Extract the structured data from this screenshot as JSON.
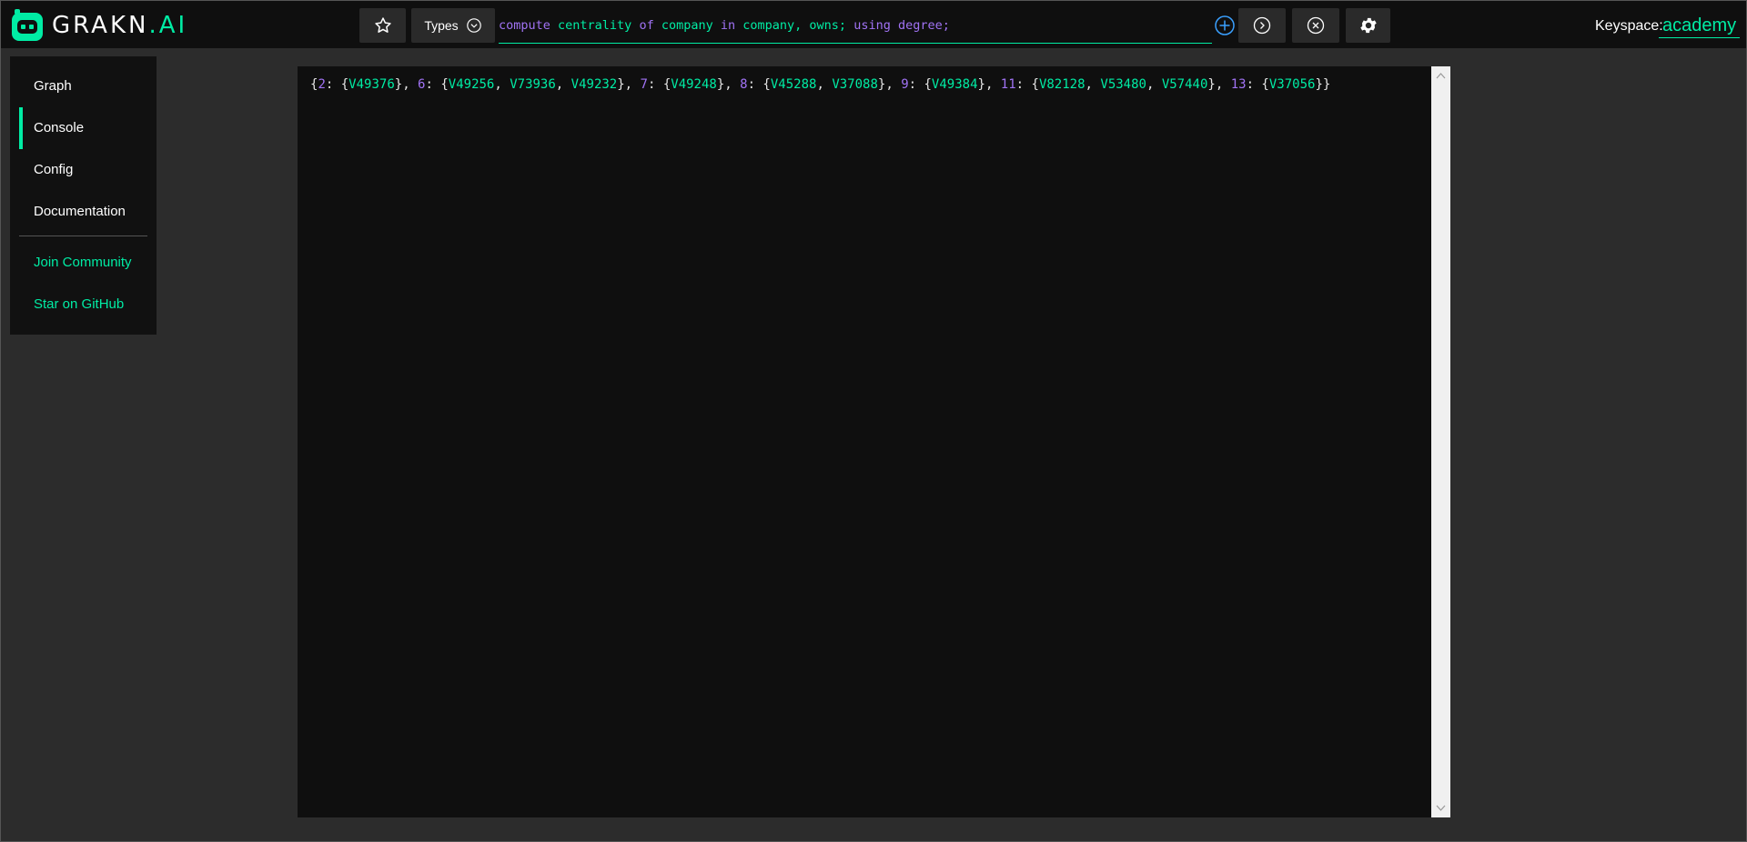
{
  "app": {
    "logo_text": "GRAKN",
    "logo_suffix": ".AI"
  },
  "toolbar": {
    "favourite_icon": "star-icon",
    "types_label": "Types",
    "query": {
      "parts": [
        {
          "text": "compute",
          "kind": "keyword"
        },
        {
          "text": " centrality ",
          "kind": "type"
        },
        {
          "text": "of",
          "kind": "keyword"
        },
        {
          "text": " company ",
          "kind": "type"
        },
        {
          "text": "in",
          "kind": "keyword"
        },
        {
          "text": " company, owns; ",
          "kind": "type"
        },
        {
          "text": "using degree;",
          "kind": "keyword"
        }
      ]
    },
    "add_icon": "plus-circle-icon",
    "run_icon": "chevron-right-circle-icon",
    "clear_icon": "x-circle-icon",
    "settings_icon": "gear-icon"
  },
  "keyspace": {
    "label": "Keyspace:",
    "value": "academy"
  },
  "sidebar": {
    "items": [
      {
        "label": "Graph",
        "active": false
      },
      {
        "label": "Console",
        "active": true
      },
      {
        "label": "Config",
        "active": false
      },
      {
        "label": "Documentation",
        "active": false
      }
    ],
    "links": [
      {
        "label": "Join Community"
      },
      {
        "label": "Star on GitHub"
      }
    ]
  },
  "console": {
    "result": [
      {
        "degree": "2",
        "ids": [
          "V49376"
        ]
      },
      {
        "degree": "6",
        "ids": [
          "V49256",
          "V73936",
          "V49232"
        ]
      },
      {
        "degree": "7",
        "ids": [
          "V49248"
        ]
      },
      {
        "degree": "8",
        "ids": [
          "V45288",
          "V37088"
        ]
      },
      {
        "degree": "9",
        "ids": [
          "V49384"
        ]
      },
      {
        "degree": "11",
        "ids": [
          "V82128",
          "V53480",
          "V57440"
        ]
      },
      {
        "degree": "13",
        "ids": [
          "V37056"
        ]
      }
    ]
  },
  "colors": {
    "accent": "#00eca4",
    "keyword": "#a173f5",
    "add_icon": "#3aa0ff",
    "background": "#2c2c2c",
    "panel": "#0f0f0f"
  }
}
